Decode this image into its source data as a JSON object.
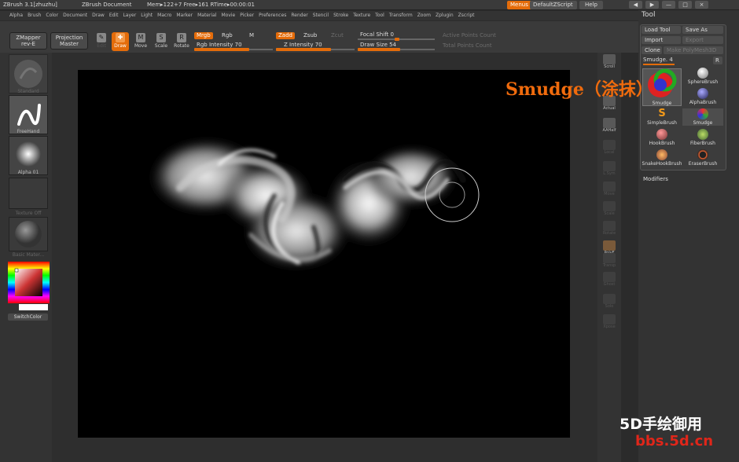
{
  "titlebar": {
    "app": "ZBrush  3.1[zhuzhu]",
    "document": "ZBrush Document",
    "mem": "Mem▸122+7 Free▸161 RTime▸00:00:01",
    "menus_btn": "Menus",
    "script_btn": "DefaultZScript",
    "help_btn": "Help"
  },
  "menubar": [
    "Alpha",
    "Brush",
    "Color",
    "Document",
    "Draw",
    "Edit",
    "Layer",
    "Light",
    "Macro",
    "Marker",
    "Material",
    "Movie",
    "Picker",
    "Preferences",
    "Render",
    "Stencil",
    "Stroke",
    "Texture",
    "Tool",
    "Transform",
    "Zoom",
    "Zplugin",
    "Zscript"
  ],
  "toolbar": {
    "zmapper": "ZMapper",
    "zmapper_sub": "rev-E",
    "projection": "Projection",
    "projection_sub": "Master",
    "edit": "Edit",
    "draw": "Draw",
    "move": "Move",
    "scale": "Scale",
    "rotate": "Rotate",
    "mrgb": "Mrgb",
    "rgb": "Rgb",
    "m": "M",
    "rgb_intensity": "Rgb Intensity 70",
    "zadd": "Zadd",
    "zsub": "Zsub",
    "zcut": "Zcut",
    "z_intensity": "Z Intensity 70",
    "focal_shift": "Focal Shift 0",
    "draw_size": "Draw Size 54",
    "active_points": "Active Points Count",
    "total_points": "Total Points Count",
    "rgb_intensity_value": 70,
    "z_intensity_value": 70,
    "draw_size_value": 54
  },
  "left": {
    "standard": "Standard",
    "freehand": "FreeHand",
    "alpha": "Alpha 01",
    "texture": "Texture Off",
    "material": "Basic Mater...",
    "switchcolor": "SwitchColor"
  },
  "shelf": [
    "Scroll",
    "Actual",
    "AAHalf",
    "Local",
    "L.Sym",
    "Move",
    "Scale",
    "Rotate",
    "PolyF",
    "Transp",
    "Ghost",
    "Solo",
    "Xpose"
  ],
  "palette": {
    "title": "Tool",
    "load_tool": "Load Tool",
    "save_as": "Save As",
    "import": "Import",
    "export": "Export",
    "clone": "Clone",
    "make_polymesh": "Make PolyMesh3D",
    "current": "Smudge. 4",
    "r_btn": "R",
    "brushes": [
      {
        "label": "Smudge"
      },
      {
        "label": "SphereBrush"
      },
      {
        "label": "AlphaBrush"
      },
      {
        "label": "SimpleBrush"
      },
      {
        "label": "Smudge"
      },
      {
        "label": "HookBrush"
      },
      {
        "label": "FiberBrush"
      },
      {
        "label": "SnakeHookBrush"
      },
      {
        "label": "EraserBrush"
      }
    ],
    "modifiers": "Modifiers"
  },
  "overlay": {
    "title": "Smudge（涂抹）",
    "watermark1": "5D手绘御用",
    "watermark2": "bbs.5d.cn"
  },
  "colors": {
    "accent": "#e46c0a",
    "title_orange": "#f06b0d",
    "watermark_red": "#e0261a"
  }
}
